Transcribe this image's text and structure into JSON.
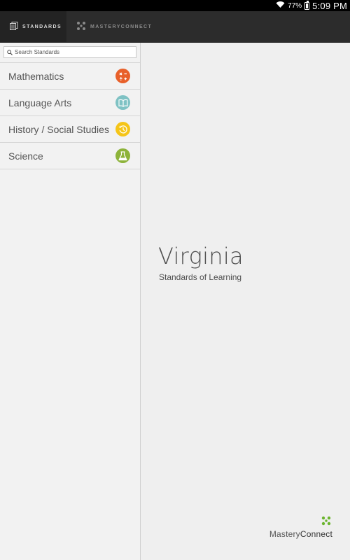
{
  "status_bar": {
    "battery": "77%",
    "time": "5:09 PM"
  },
  "tabs": [
    {
      "label": "STANDARDS",
      "icon": "standards-icon",
      "active": true
    },
    {
      "label": "MASTERYCONNECT",
      "icon": "masteryconnect-logo-icon",
      "active": false
    }
  ],
  "search": {
    "placeholder": "Search Standards",
    "value": ""
  },
  "subjects": [
    {
      "label": "Mathematics",
      "icon": "math-operators-icon",
      "color": "#e8602a"
    },
    {
      "label": "Language Arts",
      "icon": "open-book-icon",
      "color": "#7fc2c4"
    },
    {
      "label": "History / Social Studies",
      "icon": "history-clock-icon",
      "color": "#f5c518"
    },
    {
      "label": "Science",
      "icon": "flask-icon",
      "color": "#8db33a"
    }
  ],
  "main": {
    "title": "Virginia",
    "subtitle": "Standards of Learning"
  },
  "brand": {
    "prefix": "Mastery",
    "suffix": "Connect",
    "accent": "#6ab42d"
  }
}
